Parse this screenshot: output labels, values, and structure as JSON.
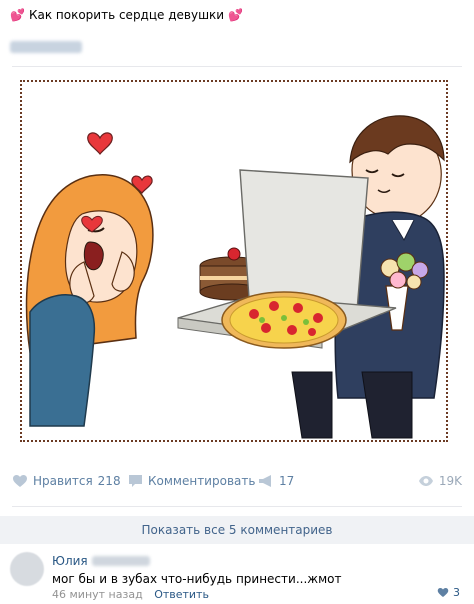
{
  "post": {
    "title": "Как покорить сердце девушки",
    "title_emoji": "💕"
  },
  "actions": {
    "like_label": "Нравится",
    "like_count": "218",
    "comment_label": "Комментировать",
    "share_count": "17",
    "views_count": "19K"
  },
  "comments": {
    "show_all_label": "Показать все 5 комментариев",
    "items": [
      {
        "author": "Юлия",
        "text": "мог бы и в зубах что-нибудь принести...жмот",
        "time": "46 минут назад",
        "reply_label": "Ответить",
        "likes": "3"
      }
    ]
  },
  "colors": {
    "link": "#2a5885",
    "action_blue": "#5e80a3",
    "muted": "#828282",
    "border_dotted": "#6b3a23",
    "heart_red": "#e8373b"
  }
}
